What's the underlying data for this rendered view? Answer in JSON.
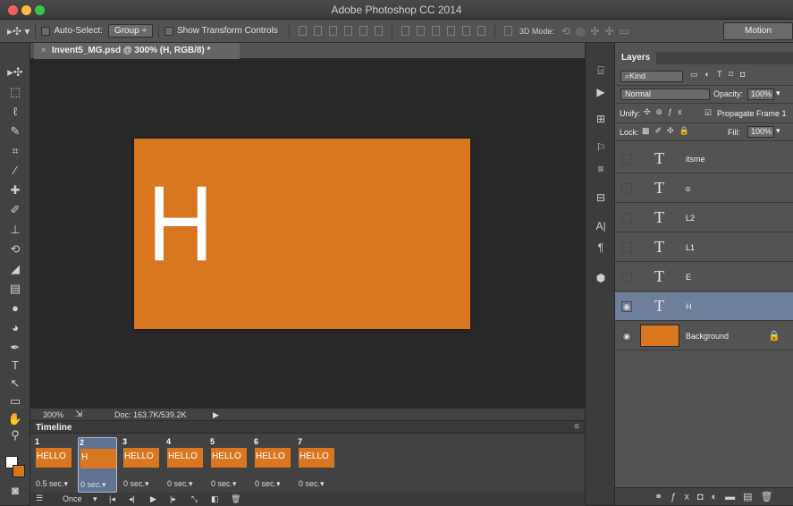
{
  "window": {
    "title": "Adobe Photoshop CC 2014"
  },
  "options_bar": {
    "auto_select_label": "Auto-Select:",
    "auto_select_value": "Group",
    "show_transform_label": "Show Transform Controls",
    "mode_3d_label": "3D Mode:",
    "workspace": "Motion"
  },
  "document": {
    "tab_label": "Invent5_MG.psd @ 300% (H, RGB/8) *",
    "canvas_letter": "H",
    "canvas_color": "#d97721"
  },
  "status": {
    "zoom": "300%",
    "doc_info": "Doc: 163.7K/539.2K"
  },
  "timeline": {
    "title": "Timeline",
    "frames": [
      {
        "num": "1",
        "thumb": "HELLO",
        "delay": "0.5 sec.▾"
      },
      {
        "num": "2",
        "thumb": "H",
        "delay": "0 sec.▾"
      },
      {
        "num": "3",
        "thumb": "HELLO",
        "delay": "0 sec.▾"
      },
      {
        "num": "4",
        "thumb": "HELLO",
        "delay": "0 sec.▾"
      },
      {
        "num": "5",
        "thumb": "HELLO",
        "delay": "0 sec.▾"
      },
      {
        "num": "6",
        "thumb": "HELLO",
        "delay": "0 sec.▾"
      },
      {
        "num": "7",
        "thumb": "HELLO",
        "delay": "0 sec.▾"
      }
    ],
    "loop": "Once"
  },
  "layers_panel": {
    "title": "Layers",
    "filter_kind": "Kind",
    "blend_mode": "Normal",
    "opacity_label": "Opacity:",
    "opacity_value": "100%",
    "unify_label": "Unify:",
    "propagate_label": "Propagate Frame 1",
    "lock_label": "Lock:",
    "fill_label": "Fill:",
    "fill_value": "100%",
    "layers": [
      {
        "name": "itsme",
        "type": "T",
        "visible": false
      },
      {
        "name": "o",
        "type": "T",
        "visible": false
      },
      {
        "name": "L2",
        "type": "T",
        "visible": false
      },
      {
        "name": "L1",
        "type": "T",
        "visible": false
      },
      {
        "name": "E",
        "type": "T",
        "visible": false
      },
      {
        "name": "H",
        "type": "T",
        "visible": true
      },
      {
        "name": "Background",
        "type": "image",
        "visible": true
      }
    ]
  }
}
